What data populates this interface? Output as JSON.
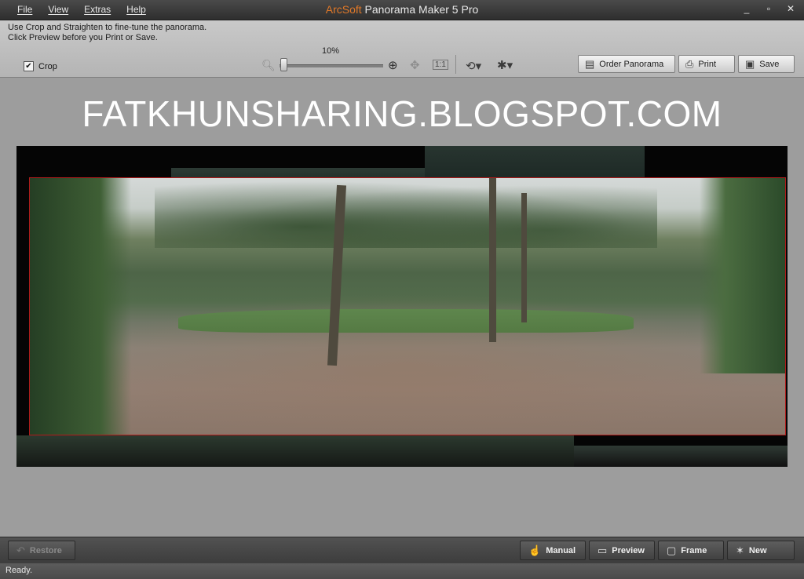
{
  "window": {
    "title_brand": "ArcSoft",
    "title_rest": "Panorama Maker 5 Pro",
    "controls": [
      "_",
      "▫",
      "✕"
    ]
  },
  "menu": [
    "File",
    "View",
    "Extras",
    "Help"
  ],
  "toolbar": {
    "hint_line1": "Use Crop and Straighten to fine-tune the panorama.",
    "hint_line2": "Click Preview before you Print or Save.",
    "crop_label": "Crop",
    "crop_checked": true,
    "zoom_label": "10%",
    "zoom_value": 10,
    "actual_size_label": "1:1",
    "order_label": "Order Panorama",
    "print_label": "Print",
    "save_label": "Save"
  },
  "watermark": "FATKHUNSHARING.BLOGSPOT.COM",
  "bottom": {
    "restore_label": "Restore",
    "manual_label": "Manual",
    "preview_label": "Preview",
    "frame_label": "Frame",
    "new_label": "New"
  },
  "status": "Ready.",
  "icons": {
    "zoom_out": "zoom-out-icon",
    "zoom_in": "zoom-in-icon",
    "move": "move-icon",
    "rotate": "rotate-icon",
    "brightness": "brightness-icon",
    "order": "order-panorama-icon",
    "print": "print-icon",
    "save": "save-icon",
    "restore": "restore-icon",
    "manual": "hand-icon",
    "preview": "preview-icon",
    "frame": "frame-icon",
    "new": "new-icon"
  },
  "colors": {
    "brand": "#e07828",
    "crop_frame": "#b11a1a",
    "background": "#9d9d9d"
  }
}
